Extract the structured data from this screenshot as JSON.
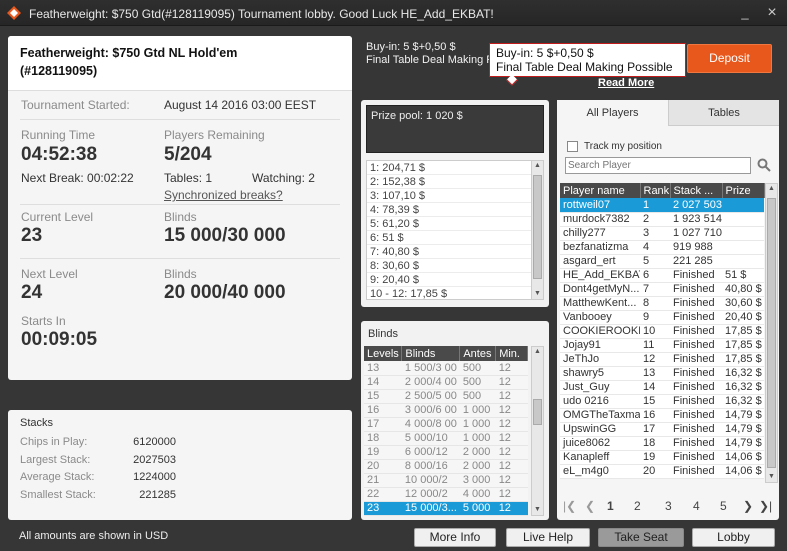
{
  "window": {
    "title": "Featherweight: $750 Gtd(#128119095) Tournament lobby. Good Luck HE_Add_EKBAT!",
    "minimize": "_",
    "close": "×"
  },
  "info": {
    "title_line1": "Featherweight: $750 Gtd NL Hold'em",
    "title_line2": "(#128119095)",
    "started_label": "Tournament Started:",
    "started_value": "August 14 2016   03:00 EEST",
    "running_label": "Running Time",
    "running_value": "04:52:38",
    "remaining_label": "Players Remaining",
    "remaining_value": "5/204",
    "next_break": "Next Break: 00:02:22",
    "tables": "Tables: 1",
    "watching": "Watching: 2",
    "sync_link": "Synchronized breaks?",
    "current_level_label": "Current Level",
    "current_level": "23",
    "blinds_label": "Blinds",
    "blinds": "15 000/30 000",
    "next_level_label": "Next Level",
    "next_level": "24",
    "next_blinds_label": "Blinds",
    "next_blinds": "20 000/40 000",
    "starts_in_label": "Starts In",
    "starts_in": "00:09:05"
  },
  "stacks": {
    "title": "Stacks",
    "rows": [
      {
        "label": "Chips in Play:",
        "value": "6120000"
      },
      {
        "label": "Largest Stack:",
        "value": "2027503"
      },
      {
        "label": "Average Stack:",
        "value": "1224000"
      },
      {
        "label": "Smallest Stack:",
        "value": "221285"
      }
    ]
  },
  "buyin": {
    "line1": "Buy-in: 5 $+0,50 $",
    "line2": "Final Table Deal Making Po"
  },
  "tooltip": {
    "line1": "Buy-in: 5 $+0,50 $",
    "line2": "Final Table Deal Making Possible"
  },
  "deposit": "Deposit",
  "read_more": "Read More",
  "prize": {
    "header": "Prize pool: 1 020 $",
    "rows": [
      "1: 204,71 $",
      "2: 152,38 $",
      "3: 107,10 $",
      "4: 78,39 $",
      "5: 61,20 $",
      "6: 51 $",
      "7: 40,80 $",
      "8: 30,60 $",
      "9: 20,40 $",
      "10 - 12: 17,85 $"
    ]
  },
  "blinds_panel": {
    "title": "Blinds",
    "headers": [
      "Levels",
      "Blinds",
      "Antes",
      "Min."
    ],
    "selected_level": "23",
    "rows": [
      [
        "13",
        "1 500/3 00",
        "500",
        "12"
      ],
      [
        "14",
        "2 000/4 00",
        "500",
        "12"
      ],
      [
        "15",
        "2 500/5 00",
        "500",
        "12"
      ],
      [
        "16",
        "3 000/6 00",
        "1 000",
        "12"
      ],
      [
        "17",
        "4 000/8 00",
        "1 000",
        "12"
      ],
      [
        "18",
        "5 000/10 ",
        "1 000",
        "12"
      ],
      [
        "19",
        "6 000/12 ",
        "2 000",
        "12"
      ],
      [
        "20",
        "8 000/16 ",
        "2 000",
        "12"
      ],
      [
        "21",
        "10 000/2",
        "3 000",
        "12"
      ],
      [
        "22",
        "12 000/2",
        "4 000",
        "12"
      ],
      [
        "23",
        "15 000/3...",
        "5 000",
        "12"
      ]
    ]
  },
  "players_panel": {
    "tab_players": "All Players",
    "tab_tables": "Tables",
    "track_label": "Track my position",
    "search_placeholder": "Search Player",
    "headers": [
      "Player name",
      "Rank",
      "Stack ...",
      "Prize"
    ],
    "selected_player": "rottweil07",
    "rows": [
      [
        "rottweil07",
        "1",
        "2 027 503",
        ""
      ],
      [
        "murdock7382",
        "2",
        "1 923 514",
        ""
      ],
      [
        "chilly277",
        "3",
        "1 027 710",
        ""
      ],
      [
        "bezfanatizma",
        "4",
        "919 988",
        ""
      ],
      [
        "asgard_ert",
        "5",
        "221 285",
        ""
      ],
      [
        "HE_Add_EKBAT",
        "6",
        "Finished",
        "51 $"
      ],
      [
        "Dont4getMyN...",
        "7",
        "Finished",
        "40,80 $"
      ],
      [
        "MatthewKent...",
        "8",
        "Finished",
        "30,60 $"
      ],
      [
        "Vanbooey",
        "9",
        "Finished",
        "20,40 $"
      ],
      [
        "COOKIEROOKIE",
        "10",
        "Finished",
        "17,85 $"
      ],
      [
        "Jojay91",
        "11",
        "Finished",
        "17,85 $"
      ],
      [
        "JeThJo",
        "12",
        "Finished",
        "17,85 $"
      ],
      [
        "shawry5",
        "13",
        "Finished",
        "16,32 $"
      ],
      [
        "Just_Guy",
        "14",
        "Finished",
        "16,32 $"
      ],
      [
        "udo 0216",
        "15",
        "Finished",
        "16,32 $"
      ],
      [
        "OMGTheTaxman",
        "16",
        "Finished",
        "14,79 $"
      ],
      [
        "UpswinGG",
        "17",
        "Finished",
        "14,79 $"
      ],
      [
        "juice8062",
        "18",
        "Finished",
        "14,79 $"
      ],
      [
        "Kanapleff",
        "19",
        "Finished",
        "14,06 $"
      ],
      [
        "eL_m4g0",
        "20",
        "Finished",
        "14,06 $"
      ]
    ],
    "pages": [
      "1",
      "2",
      "3",
      "4",
      "5"
    ]
  },
  "footer": {
    "note": "All amounts are shown in USD",
    "more_info": "More Info",
    "live_help": "Live Help",
    "take_seat": "Take Seat",
    "lobby": "Lobby"
  }
}
